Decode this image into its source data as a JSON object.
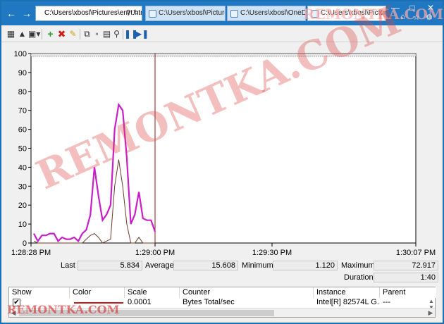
{
  "browser": {
    "address": "C:\\Users\\xbosl\\Pictures\\errrt.htm",
    "tabs": [
      {
        "label": "C:\\Users\\xbosl\\Pictures\\test..."
      },
      {
        "label": "C:\\Users\\xbosl\\OneDrive - F..."
      },
      {
        "label": "C:\\Users\\xbosl\\Pictures\\..."
      }
    ]
  },
  "watermark": "REMONTKA.COM",
  "chart_data": {
    "type": "line",
    "ylim": [
      0,
      100
    ],
    "yticks": [
      "0",
      "10",
      "20",
      "30",
      "40",
      "50",
      "60",
      "70",
      "80",
      "90",
      "100"
    ],
    "xticks": [
      "1:28:28 PM",
      "1:29:00 PM",
      "1:29:30 PM",
      "1:30:07 PM"
    ],
    "time_cursor": "1:29:00 PM",
    "series": [
      {
        "color": "#c81fc8",
        "values": [
          5,
          1,
          4,
          4,
          5,
          5,
          1,
          3,
          2,
          2,
          3,
          1,
          5,
          7,
          15,
          40,
          25,
          12,
          15,
          20,
          60,
          73,
          70,
          45,
          10,
          15,
          27,
          13,
          12,
          12,
          6
        ]
      },
      {
        "color": "#6b3a2a",
        "values": [
          1,
          0,
          0,
          0,
          0,
          0,
          0,
          0,
          0,
          0,
          0,
          0,
          0,
          2,
          4,
          5,
          3,
          0,
          1,
          2,
          30,
          44,
          30,
          10,
          0,
          0,
          3,
          0,
          0,
          0,
          0
        ]
      }
    ]
  },
  "stats": {
    "last_label": "Last",
    "last": "5.834",
    "average_label": "Average",
    "average": "15.608",
    "minimum_label": "Minimum",
    "minimum": "1.120",
    "maximum_label": "Maximum",
    "maximum": "72.917",
    "duration_label": "Duration",
    "duration": "1:40"
  },
  "table": {
    "headers": {
      "show": "Show",
      "color": "Color",
      "scale": "Scale",
      "counter": "Counter",
      "instance": "Instance",
      "parent": "Parent"
    },
    "rows": [
      {
        "show": "✔",
        "scale": "0.0001",
        "counter": "Bytes Total/sec",
        "instance": "Intel[R] 82574L G...",
        "parent": "---"
      }
    ]
  }
}
